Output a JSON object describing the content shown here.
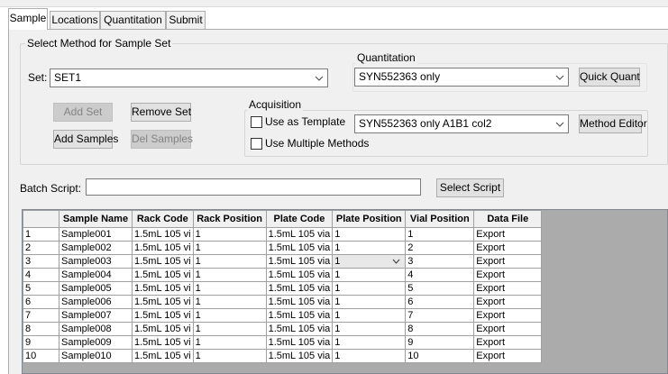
{
  "tabs": [
    {
      "label": "Sample",
      "active": true
    },
    {
      "label": "Locations",
      "active": false
    },
    {
      "label": "Quantitation",
      "active": false
    },
    {
      "label": "Submit",
      "active": false
    }
  ],
  "method_group": {
    "title": "Select Method for Sample Set",
    "set_label": "Set:",
    "set_value": "SET1",
    "buttons": {
      "add_set": "Add Set",
      "remove_set": "Remove Set",
      "add_samples": "Add Samples",
      "del_samples": "Del Samples"
    }
  },
  "quantitation_group": {
    "title": "Quantitation",
    "value": "SYN552363 only",
    "quick_quant": "Quick Quant"
  },
  "acquisition_group": {
    "title": "Acquisition",
    "use_as_template": "Use as Template",
    "use_multiple_methods": "Use Multiple Methods",
    "method_value": "SYN552363 only A1B1 col2",
    "method_editor": "Method Editor"
  },
  "batch": {
    "label": "Batch Script:",
    "value": "",
    "select_script": "Select Script"
  },
  "grid": {
    "columns": [
      "Sample Name",
      "Rack Code",
      "Rack Position",
      "Plate Code",
      "Plate Position",
      "Vial Position",
      "Data File"
    ],
    "rows": [
      {
        "n": "1",
        "cells": [
          "Sample001",
          "1.5mL 105 vi",
          "1",
          "1.5mL 105 via",
          "1",
          "1",
          "Export"
        ]
      },
      {
        "n": "2",
        "cells": [
          "Sample002",
          "1.5mL 105 vi",
          "1",
          "1.5mL 105 via",
          "1",
          "2",
          "Export"
        ]
      },
      {
        "n": "3",
        "cells": [
          "Sample003",
          "1.5mL 105 vi",
          "1",
          "1.5mL 105 via",
          "1",
          "3",
          "Export"
        ]
      },
      {
        "n": "4",
        "cells": [
          "Sample004",
          "1.5mL 105 vi",
          "1",
          "1.5mL 105 via",
          "1",
          "4",
          "Export"
        ]
      },
      {
        "n": "5",
        "cells": [
          "Sample005",
          "1.5mL 105 vi",
          "1",
          "1.5mL 105 via",
          "1",
          "5",
          "Export"
        ]
      },
      {
        "n": "6",
        "cells": [
          "Sample006",
          "1.5mL 105 vi",
          "1",
          "1.5mL 105 via",
          "1",
          "6",
          "Export"
        ]
      },
      {
        "n": "7",
        "cells": [
          "Sample007",
          "1.5mL 105 vi",
          "1",
          "1.5mL 105 via",
          "1",
          "7",
          "Export"
        ]
      },
      {
        "n": "8",
        "cells": [
          "Sample008",
          "1.5mL 105 vi",
          "1",
          "1.5mL 105 via",
          "1",
          "8",
          "Export"
        ]
      },
      {
        "n": "9",
        "cells": [
          "Sample009",
          "1.5mL 105 vi",
          "1",
          "1.5mL 105 via",
          "1",
          "9",
          "Export"
        ]
      },
      {
        "n": "10",
        "cells": [
          "Sample010",
          "1.5mL 105 vi",
          "1",
          "1.5mL 105 via",
          "1",
          "10",
          "Export"
        ]
      }
    ]
  }
}
